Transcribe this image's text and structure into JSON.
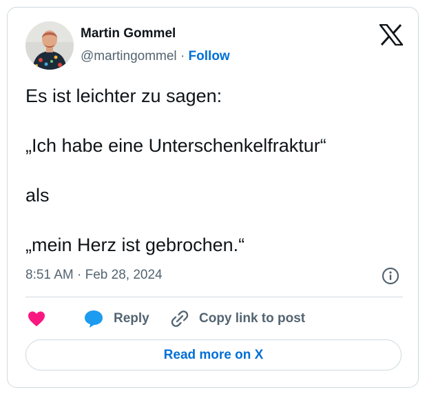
{
  "author": {
    "name": "Martin Gommel",
    "handle": "@martingommel",
    "separator": "·",
    "follow_label": "Follow"
  },
  "tweet": {
    "lines": [
      "Es ist leichter zu sagen:",
      "„Ich habe eine Unterschenkelfraktur“",
      "als",
      "„mein Herz ist gebrochen.“"
    ],
    "time": "8:51 AM",
    "separator": "·",
    "date": "Feb 28, 2024"
  },
  "actions": {
    "like_icon": "heart-icon",
    "reply_label": "Reply",
    "copy_label": "Copy link to post"
  },
  "read_more_label": "Read more on X",
  "colors": {
    "accent": "#006fd6",
    "heart": "#f91880",
    "reply_bubble": "#1d9bf0",
    "muted": "#536471",
    "border": "#cfd9de"
  }
}
